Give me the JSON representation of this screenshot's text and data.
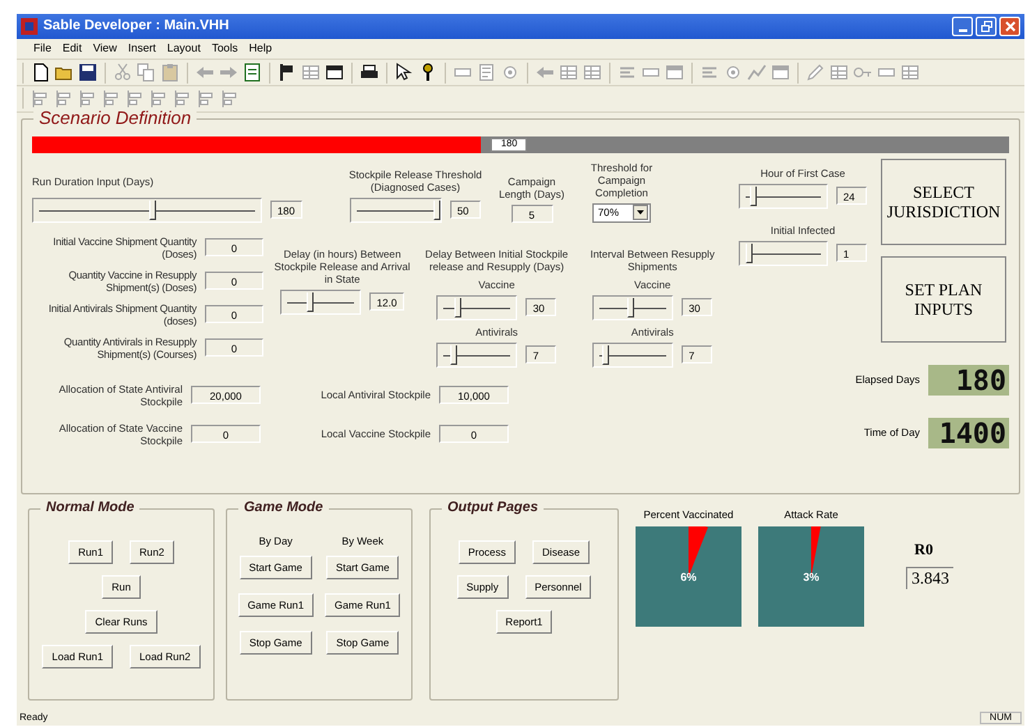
{
  "window": {
    "title": "Sable Developer : Main.VHH"
  },
  "menu": [
    "File",
    "Edit",
    "View",
    "Insert",
    "Layout",
    "Tools",
    "Help"
  ],
  "scenario": {
    "title": "Scenario Definition",
    "progress": {
      "level": 0.46,
      "label": "180"
    },
    "run_duration": {
      "label": "Run Duration Input (Days)",
      "level": 0.52,
      "value": "180"
    },
    "stockpile_threshold": {
      "label": "Stockpile Release Threshold (Diagnosed Cases)",
      "level": 0.95,
      "value": "50"
    },
    "campaign_length": {
      "label": "Campaign Length (Days)",
      "value": "5"
    },
    "completion_threshold": {
      "label": "Threshold for Campaign Completion",
      "value": "70%"
    },
    "quantities": [
      {
        "label": "Initial Vaccine Shipment Quantity (Doses)",
        "value": "0"
      },
      {
        "label": "Quantity Vaccine in Resupply Shipment(s) (Doses)",
        "value": "0"
      },
      {
        "label": "Initial Antivirals Shipment Quantity (doses)",
        "value": "0"
      },
      {
        "label": "Quantity Antivirals in Resupply Shipment(s) (Courses)",
        "value": "0"
      }
    ],
    "delay_hours": {
      "label": "Delay (in hours) Between Stockpile Release and Arrival in State",
      "level": 0.35,
      "value": "12.0"
    },
    "resupply_delay": {
      "label": "Delay Between Initial Stockpile release and Resupply (Days)",
      "sliders": [
        {
          "label": "Vaccine",
          "level": 0.25,
          "value": "30"
        },
        {
          "label": "Antivirals",
          "level": 0.2,
          "value": "7"
        }
      ]
    },
    "resupply_interval": {
      "label": "Interval Between Resupply Shipments",
      "sliders": [
        {
          "label": "Vaccine",
          "level": 0.45,
          "value": "30"
        },
        {
          "label": "Antivirals",
          "level": 0.15,
          "value": "7"
        }
      ]
    },
    "stockpiles": [
      {
        "label": "Allocation of State Antiviral Stockpile",
        "value": "20,000"
      },
      {
        "label": "Local Antiviral Stockpile",
        "value": "10,000"
      },
      {
        "label": "Allocation of State Vaccine Stockpile",
        "value": "0"
      },
      {
        "label": "Local Vaccine Stockpile",
        "value": "0"
      }
    ],
    "first_case": {
      "label": "Hour of First Case",
      "level": 0.15,
      "value": "24"
    },
    "initial_infected": {
      "label": "Initial Infected",
      "level": 0.1,
      "value": "1"
    },
    "buttons": [
      "SELECT JURISDICTION",
      "SET PLAN INPUTS"
    ],
    "displays": [
      {
        "label": "Elapsed Days",
        "value": "180"
      },
      {
        "label": "Time of Day",
        "value": "1400"
      }
    ]
  },
  "normal_mode": {
    "title": "Normal Mode",
    "rows": [
      [
        "Run1",
        "Run2"
      ],
      [
        "Run"
      ],
      [
        "Clear Runs"
      ],
      [
        "Load Run1",
        "Load Run2"
      ]
    ]
  },
  "game_mode": {
    "title": "Game Mode",
    "columns": [
      {
        "heading": "By Day",
        "buttons": [
          "Start Game",
          "Game Run1",
          "Stop Game"
        ]
      },
      {
        "heading": "By Week",
        "buttons": [
          "Start Game",
          "Game Run1",
          "Stop Game"
        ]
      }
    ]
  },
  "output_pages": {
    "title": "Output Pages",
    "rows": [
      [
        "Process",
        "Disease"
      ],
      [
        "Supply",
        "Personnel"
      ],
      [
        "Report1"
      ]
    ]
  },
  "gauges": [
    {
      "title": "Percent Vaccinated",
      "reading": "6%"
    },
    {
      "title": "Attack Rate",
      "reading": "3%"
    }
  ],
  "r0": {
    "label": "R0",
    "value": "3.843"
  },
  "status_bar": {
    "text": "Ready",
    "indicator": "NUM"
  }
}
